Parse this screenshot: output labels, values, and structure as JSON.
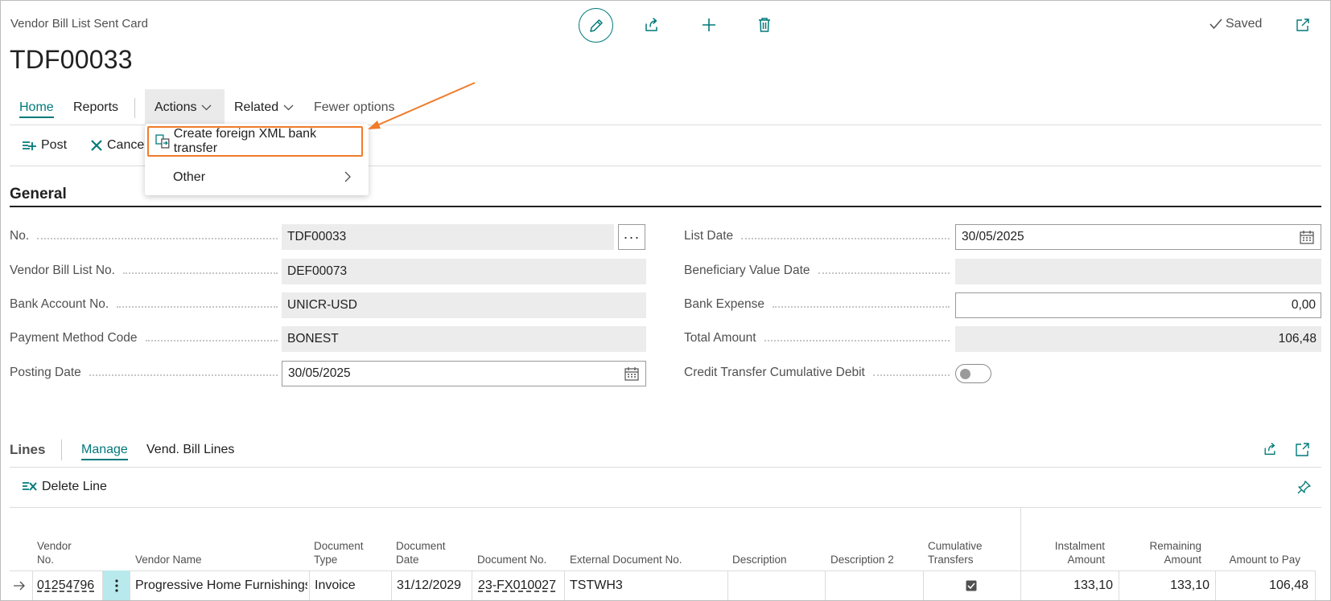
{
  "header": {
    "caption": "Vendor Bill List Sent Card",
    "title": "TDF00033",
    "saved_label": "Saved"
  },
  "tabs": {
    "home": "Home",
    "reports": "Reports",
    "actions": "Actions",
    "related": "Related",
    "fewer_options": "Fewer options"
  },
  "toolbar": {
    "post": "Post",
    "cancel": "Cancel"
  },
  "actions_menu": {
    "create_foreign_xml": "Create foreign XML bank transfer",
    "other": "Other"
  },
  "general": {
    "title": "General",
    "fields": {
      "no": {
        "label": "No.",
        "value": "TDF00033"
      },
      "vendor_bill_list_no": {
        "label": "Vendor Bill List No.",
        "value": "DEF00073"
      },
      "bank_account_no": {
        "label": "Bank Account No.",
        "value": "UNICR-USD"
      },
      "payment_method_code": {
        "label": "Payment Method Code",
        "value": "BONEST"
      },
      "posting_date": {
        "label": "Posting Date",
        "value": "30/05/2025"
      },
      "list_date": {
        "label": "List Date",
        "value": "30/05/2025"
      },
      "beneficiary_value_date": {
        "label": "Beneficiary Value Date",
        "value": ""
      },
      "bank_expense": {
        "label": "Bank Expense",
        "value": "0,00"
      },
      "total_amount": {
        "label": "Total Amount",
        "value": "106,48"
      },
      "credit_transfer_cumulative_debit": {
        "label": "Credit Transfer Cumulative Debit",
        "value": false
      }
    },
    "ellipsis": "···"
  },
  "lines": {
    "title": "Lines",
    "tabs": {
      "manage": "Manage",
      "vend_bill_lines": "Vend. Bill Lines"
    },
    "delete_line": "Delete Line",
    "columns": {
      "vendor_no": [
        "Vendor",
        "No."
      ],
      "vendor_name": "Vendor Name",
      "document_type": [
        "Document",
        "Type"
      ],
      "document_date": [
        "Document",
        "Date"
      ],
      "document_no": "Document No.",
      "external_document_no": "External Document No.",
      "description": "Description",
      "description2": "Description 2",
      "cumulative_transfers": [
        "Cumulative",
        "Transfers"
      ],
      "instalment_amount": [
        "Instalment",
        "Amount"
      ],
      "remaining_amount": [
        "Remaining",
        "Amount"
      ],
      "amount_to_pay": "Amount to Pay"
    },
    "rows": [
      {
        "vendor_no": "01254796",
        "vendor_name": "Progressive Home Furnishings",
        "document_type": "Invoice",
        "document_date": "31/12/2029",
        "document_no": "23-FX010027",
        "external_document_no": "TSTWH3",
        "description": "",
        "description2": "",
        "cumulative_transfers": true,
        "instalment_amount": "133,10",
        "remaining_amount": "133,10",
        "amount_to_pay": "106,48"
      }
    ]
  },
  "colors": {
    "accent": "#00797a",
    "highlight": "#f07b2a",
    "field_bg": "#ececec"
  }
}
